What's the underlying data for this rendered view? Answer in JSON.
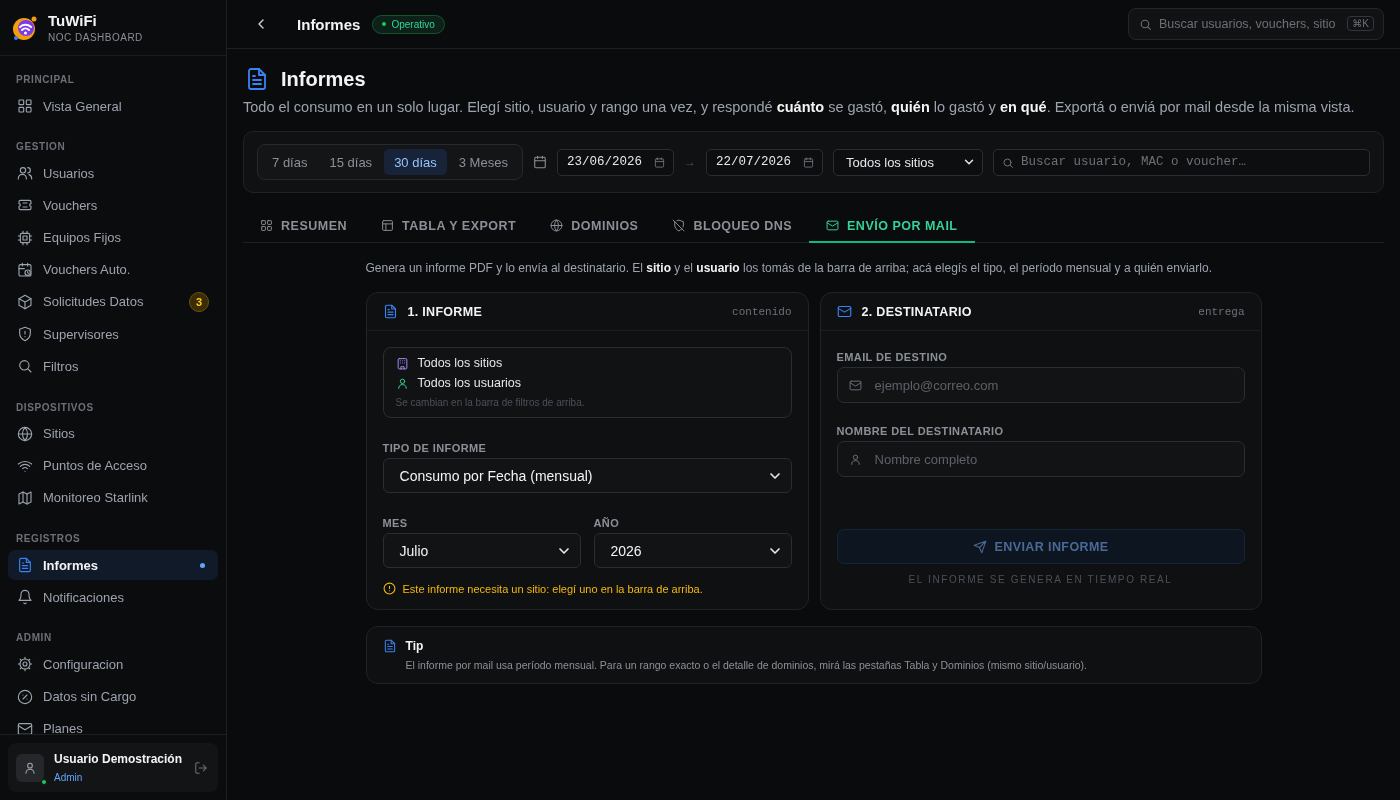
{
  "brand": {
    "name": "TuWiFi",
    "subtitle": "NOC DASHBOARD"
  },
  "sidebar": {
    "sections": [
      {
        "title": "PRINCIPAL",
        "items": [
          {
            "label": "Vista General",
            "selected": false
          }
        ]
      },
      {
        "title": "GESTION",
        "items": [
          {
            "label": "Usuarios",
            "selected": false
          },
          {
            "label": "Vouchers",
            "selected": false
          },
          {
            "label": "Equipos Fijos",
            "selected": false
          },
          {
            "label": "Vouchers Auto.",
            "selected": false
          },
          {
            "label": "Solicitudes Datos",
            "selected": false,
            "badge": "3"
          },
          {
            "label": "Supervisores",
            "selected": false
          },
          {
            "label": "Filtros",
            "selected": false
          }
        ]
      },
      {
        "title": "DISPOSITIVOS",
        "items": [
          {
            "label": "Sitios",
            "selected": false
          },
          {
            "label": "Puntos de Acceso",
            "selected": false
          },
          {
            "label": "Monitoreo Starlink",
            "selected": false
          }
        ]
      },
      {
        "title": "REGISTROS",
        "items": [
          {
            "label": "Informes",
            "selected": true
          },
          {
            "label": "Notificaciones",
            "selected": false
          }
        ]
      },
      {
        "title": "ADMIN",
        "items": [
          {
            "label": "Configuracion",
            "selected": false
          },
          {
            "label": "Datos sin Cargo",
            "selected": false
          },
          {
            "label": "Planes",
            "selected": false
          }
        ]
      }
    ]
  },
  "user": {
    "name": "Usuario Demostración",
    "role": "Admin",
    "online": true
  },
  "topbar": {
    "title": "Informes",
    "status": "Operativo",
    "search_placeholder": "Buscar usuarios, vouchers, sitio",
    "shortcut": "⌘K"
  },
  "page": {
    "title": "Informes",
    "description": "Todo el consumo en un solo lugar. Elegí sitio, usuario y rango una vez, y respondé **cuánto** se gastó, **quién** lo gastó y **en qué**. Exportá o enviá por mail desde la misma vista."
  },
  "filters": {
    "ranges": [
      {
        "label": "7 días",
        "selected": false
      },
      {
        "label": "15 días",
        "selected": false
      },
      {
        "label": "30 días",
        "selected": true
      },
      {
        "label": "3 Meses",
        "selected": false
      }
    ],
    "date_from": "23/06/2026",
    "date_to": "22/07/2026",
    "separator": "→",
    "site": "Todos los sitios",
    "search_placeholder": "Buscar usuario, MAC o voucher…"
  },
  "tabs": [
    {
      "label": "RESUMEN",
      "selected": false
    },
    {
      "label": "TABLA Y EXPORT",
      "selected": false
    },
    {
      "label": "DOMINIOS",
      "selected": false
    },
    {
      "label": "BLOQUEO DNS",
      "selected": false
    },
    {
      "label": "ENVÍO POR MAIL",
      "selected": true
    }
  ],
  "mail": {
    "intro": "Genera un informe PDF y lo envía al destinatario. El **sitio** y el **usuario** los tomás de la barra de arriba; acá elegís el tipo, el período mensual y a quién enviarlo.",
    "report_card": {
      "title": "1. INFORME",
      "tag": "contenido",
      "scope_site": "Todos los sitios",
      "scope_user": "Todos los usuarios",
      "scope_hint": "Se cambian en la barra de filtros de arriba.",
      "type_label": "TIPO DE INFORME",
      "type_value": "Consumo por Fecha (mensual)",
      "month_label": "MES",
      "month_value": "Julio",
      "year_label": "AÑO",
      "year_value": "2026",
      "warning": "Este informe necesita un sitio: elegí uno en la barra de arriba."
    },
    "recipient_card": {
      "title": "2. DESTINATARIO",
      "tag": "entrega",
      "email_label": "EMAIL DE DESTINO",
      "email_placeholder": "ejemplo@correo.com",
      "name_label": "NOMBRE DEL DESTINATARIO",
      "name_placeholder": "Nombre completo",
      "send_button": "ENVIAR INFORME",
      "send_disabled": true,
      "footnote": "EL INFORME SE GENERA EN TIEMPO REAL"
    },
    "tip": {
      "title": "Tip",
      "text": "El informe por mail usa período mensual. Para un rango exacto o el detalle de dominios, mirá las pestañas Tabla y Dominios (mismo sitio/usuario)."
    }
  }
}
